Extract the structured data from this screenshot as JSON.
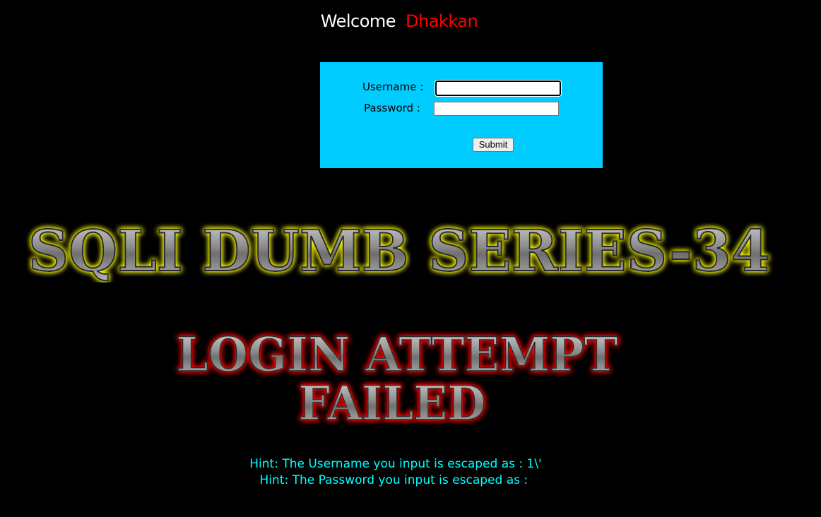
{
  "header": {
    "welcome_label": "Welcome",
    "user_name": "Dhakkan"
  },
  "login_form": {
    "username_label": "Username :",
    "username_value": "",
    "password_label": "Password :",
    "password_value": "",
    "submit_label": "Submit",
    "background_color": "#00ccff"
  },
  "title_image": {
    "text": "SQLI DUMB SERIES-34",
    "glow_color": "#ffff00"
  },
  "result_image": {
    "line1": "LOGIN ATTEMPT",
    "line2": "FAILED",
    "glow_color": "#ff0000"
  },
  "hints": {
    "username_hint": "Hint: The Username you input is escaped as : 1\\'",
    "password_hint": "Hint: The Password you input is escaped as : "
  }
}
